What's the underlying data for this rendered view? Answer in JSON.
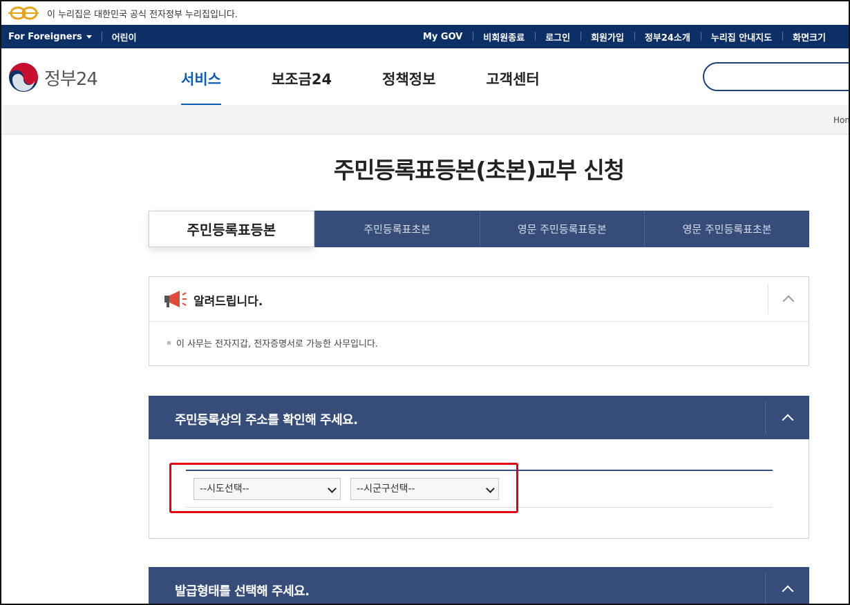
{
  "gov_banner": {
    "text": "이 누리집은 대한민국 공식 전자정부 누리집입니다."
  },
  "topbar": {
    "for_foreigners": "For Foreigners",
    "kids": "어린이",
    "links": [
      "My GOV",
      "비회원종료",
      "로그인",
      "회원가입",
      "정부24소개",
      "누리집 안내지도",
      "화면크기"
    ]
  },
  "header": {
    "logo_text": "정부24",
    "menu": [
      "서비스",
      "보조금24",
      "정책정보",
      "고객센터"
    ],
    "active_menu": "서비스"
  },
  "breadcrumb": {
    "home": "Home"
  },
  "page": {
    "title": "주민등록표등본(초본)교부 신청"
  },
  "tabs": [
    "주민등록표등본",
    "주민등록표초본",
    "영문 주민등록표등본",
    "영문 주민등록표초본"
  ],
  "notice": {
    "title": "알려드립니다.",
    "text": "이 사무는 전자지갑, 전자증명서로 가능한 사무입니다."
  },
  "address_section": {
    "title": "주민등록상의 주소를 확인해 주세요.",
    "sido_select": "--시도선택--",
    "sigungu_select": "--시군구선택--"
  },
  "issue_section": {
    "title": "발급형태를 선택해 주세요."
  },
  "colors": {
    "navy": "#0c2f66",
    "section_blue": "#364d7a",
    "accent": "#0c5cb5",
    "highlight": "#e60012"
  }
}
